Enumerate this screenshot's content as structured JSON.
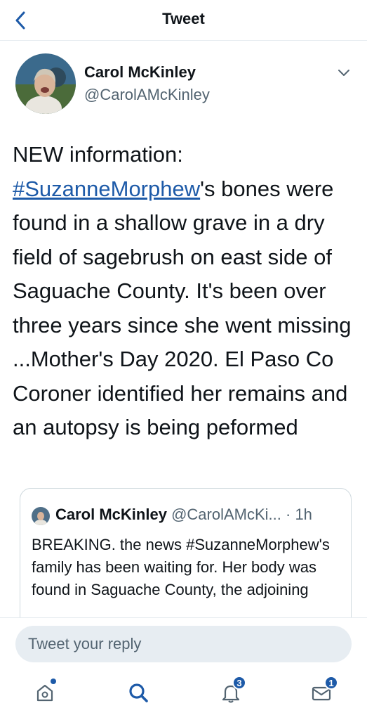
{
  "header": {
    "title": "Tweet",
    "back_icon": "chevron-left-icon"
  },
  "author": {
    "name": "Carol McKinley",
    "handle": "@CarolAMcKinley"
  },
  "tweet": {
    "line1": "NEW information:",
    "hashtag": "#SuzanneMorphew",
    "after_hashtag": "'s bones were found in a shallow grave in a dry field of sagebrush on east side of Saguache County. It's been over three years since she went missing ...Mother's Day 2020.  El Paso Co Coroner identified her remains and an autopsy is being peformed"
  },
  "quoted": {
    "name": "Carol McKinley",
    "handle": "@CarolAMcKi...",
    "time": "· 1h",
    "text": "BREAKING. the news #SuzanneMorphew's family has been waiting for. Her body was found in Saguache County, the adjoining"
  },
  "reply": {
    "placeholder": "Tweet your reply"
  },
  "tabs": {
    "home_icon": "home-icon",
    "search_icon": "search-icon",
    "notifications_icon": "bell-icon",
    "notifications_count": "3",
    "messages_icon": "mail-icon",
    "messages_count": "1"
  },
  "colors": {
    "accent": "#1d5aa8",
    "text": "#0f1419",
    "muted": "#536471"
  }
}
